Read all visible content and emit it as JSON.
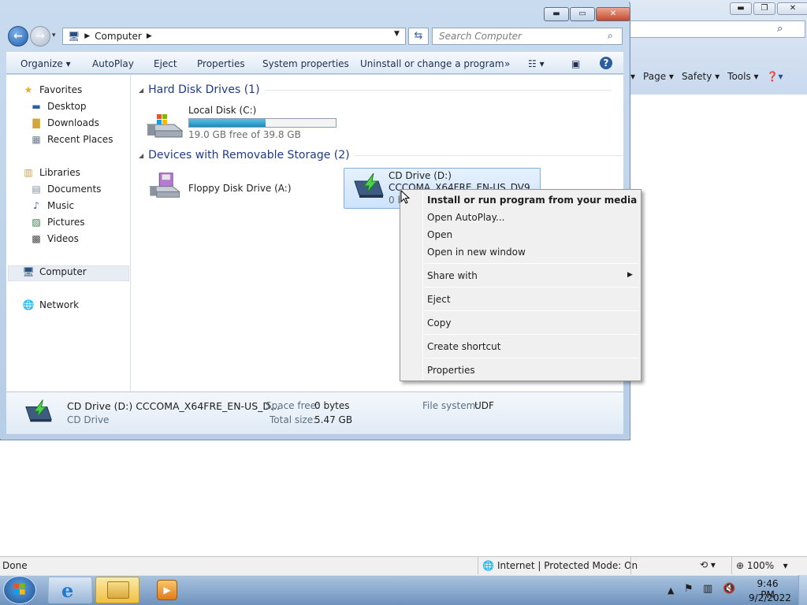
{
  "ie": {
    "command_bar": [
      "Page",
      "Safety",
      "Tools"
    ],
    "status_done": "Done",
    "status_zone": "Internet | Protected Mode: On",
    "zoom": "100%"
  },
  "explorer": {
    "address": "Computer",
    "search_placeholder": "Search Computer",
    "toolbar": {
      "organize": "Organize",
      "autoplay": "AutoPlay",
      "eject": "Eject",
      "properties": "Properties",
      "system_properties": "System properties",
      "uninstall": "Uninstall or change a program",
      "more": "»"
    },
    "nav": {
      "favorites": "Favorites",
      "desktop": "Desktop",
      "downloads": "Downloads",
      "recent_places": "Recent Places",
      "libraries": "Libraries",
      "documents": "Documents",
      "music": "Music",
      "pictures": "Pictures",
      "videos": "Videos",
      "computer": "Computer",
      "network": "Network"
    },
    "groups": {
      "hard_disks": "Hard Disk Drives (1)",
      "removable": "Devices with Removable Storage (2)"
    },
    "drives": {
      "local_disk_name": "Local Disk (C:)",
      "local_disk_free": "19.0 GB free of 39.8 GB",
      "local_disk_used_fraction": 0.52,
      "floppy_name": "Floppy Disk Drive (A:)",
      "cd_name": "CD Drive (D:)",
      "cd_label": "CCCOMA_X64FRE_EN-US_DV9",
      "cd_free": "0 bytes"
    },
    "details": {
      "title": "CD Drive (D:) CCCOMA_X64FRE_EN-US_D...",
      "type": "CD Drive",
      "space_free_label": "Space free:",
      "space_free": "0 bytes",
      "total_size_label": "Total size:",
      "total_size": "5.47 GB",
      "file_system_label": "File system:",
      "file_system": "UDF"
    }
  },
  "context_menu": {
    "install": "Install or run program from your media",
    "open_autoplay": "Open AutoPlay...",
    "open": "Open",
    "open_new_window": "Open in new window",
    "share_with": "Share with",
    "eject": "Eject",
    "copy": "Copy",
    "create_shortcut": "Create shortcut",
    "properties": "Properties"
  },
  "taskbar": {
    "time": "9:46 PM",
    "date": "9/2/2022"
  },
  "colors": {
    "selection": "#cde3fb",
    "group_header": "#1e3a8a",
    "taskbar": "#6f93bd"
  }
}
